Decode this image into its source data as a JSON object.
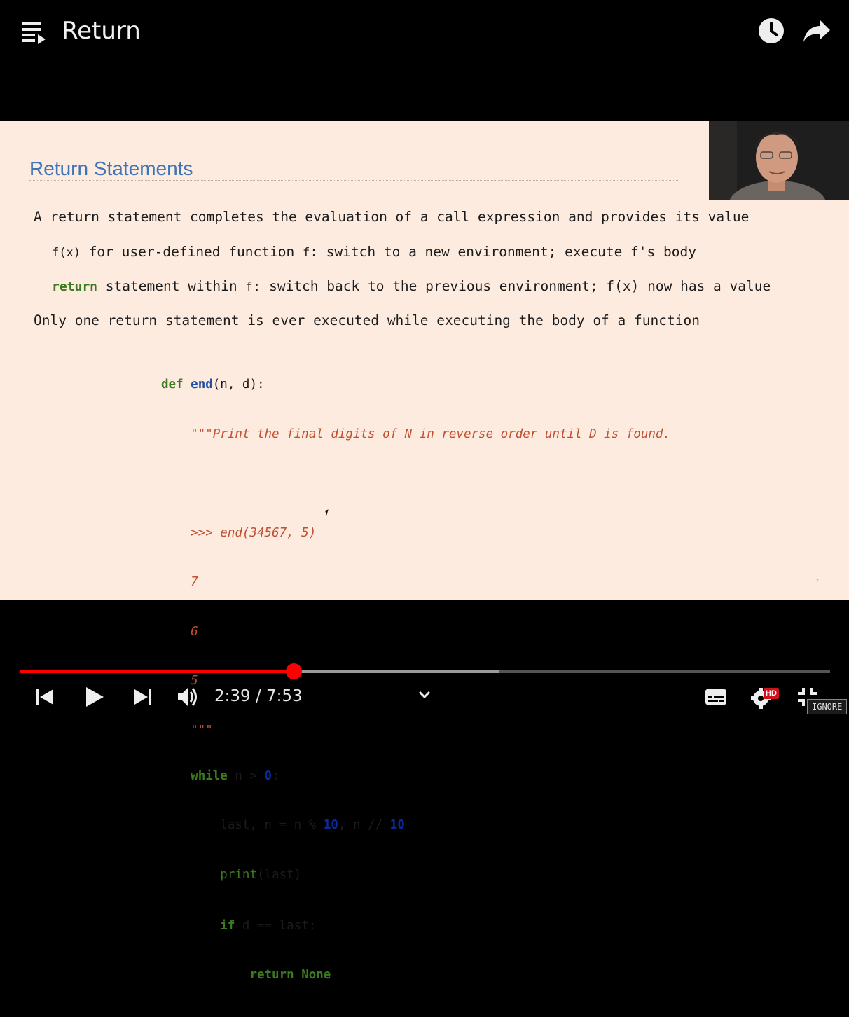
{
  "player": {
    "title": "Return",
    "current_time": "2:39",
    "separator": " / ",
    "duration": "7:53",
    "played_fraction": 0.337,
    "buffered_fraction": 0.592,
    "hd_label": "HD",
    "ignore_label": "IGNORE",
    "icons": [
      "playlist-icon",
      "watch-later-icon",
      "share-icon",
      "previous-icon",
      "play-icon",
      "next-icon",
      "volume-icon",
      "chevron-down-icon",
      "subtitles-icon",
      "settings-icon",
      "exit-fullscreen-icon"
    ]
  },
  "slide": {
    "title": "Return Statements",
    "page_number": "7",
    "bullets": {
      "b1": "A return statement completes the evaluation of a call expression and provides its value",
      "b2_a": "f(x)",
      "b2_b": " for user-defined function ",
      "b2_c": "f",
      "b2_d": ": switch to a new environment; execute f's body",
      "b3_kw": "return",
      "b3_a": " statement within ",
      "b3_b": "f",
      "b3_c": ": switch back to the previous environment; f(x) now has a value",
      "b4": "Only one return statement is ever executed while executing the body of a function"
    },
    "code": {
      "l1_def": "def",
      "l1_name": "end",
      "l1_rest": "(n, d):",
      "l2": "    \"\"\"Print the final digits of N in reverse order until D is found.",
      "l3": "",
      "l4": "    >>> end(34567, 5)",
      "l5": "    7",
      "l6": "    6",
      "l7": "    5",
      "l8": "    \"\"\"",
      "l9_kw": "while",
      "l9_a": " n > ",
      "l9_num": "0",
      "l9_b": ":",
      "l10_a": "last, n = n % ",
      "l10_n1": "10",
      "l10_b": ", n // ",
      "l10_n2": "10",
      "l11_fn": "print",
      "l11_rest": "(last)",
      "l12_kw": "if",
      "l12_rest": " d == last:",
      "l13": "return None"
    }
  }
}
